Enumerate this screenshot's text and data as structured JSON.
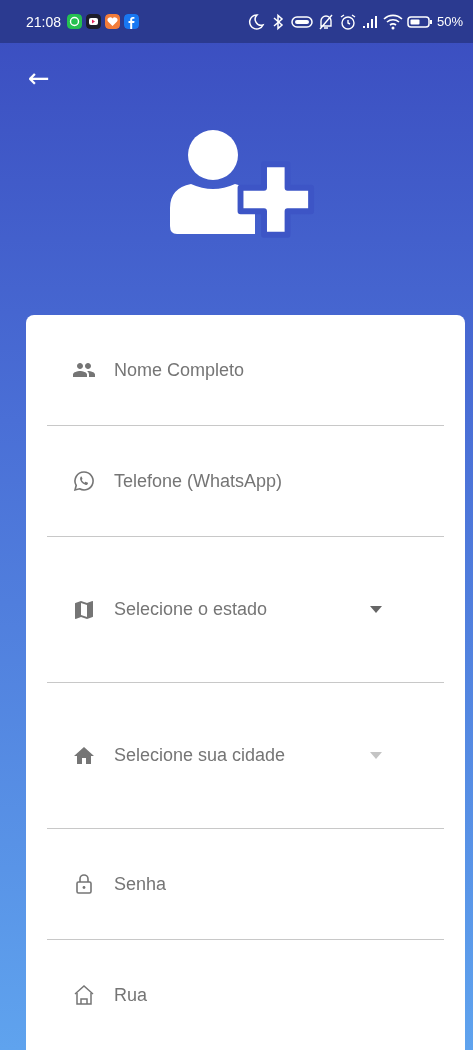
{
  "status_bar": {
    "time": "21:08",
    "battery": "50%"
  },
  "header": {
    "back": "←"
  },
  "form": {
    "fields": [
      {
        "kind": "text",
        "placeholder": "Nome Completo"
      },
      {
        "kind": "text",
        "placeholder": "Telefone (WhatsApp)"
      },
      {
        "kind": "dropdown",
        "placeholder": "Selecione o estado",
        "disabled": false
      },
      {
        "kind": "dropdown",
        "placeholder": "Selecione sua cidade",
        "disabled": true
      },
      {
        "kind": "text",
        "placeholder": "Senha"
      },
      {
        "kind": "text",
        "placeholder": "Rua"
      }
    ]
  }
}
